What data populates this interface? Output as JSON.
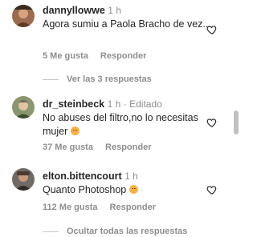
{
  "comments": [
    {
      "username": "dannyllowwe",
      "time": "1 h",
      "edited": "",
      "text": "Agora sumiu a Paola Bracho de vez...",
      "likes": "5 Me gusta",
      "reply": "Responder",
      "view_replies": "Ver las 3 respuestas"
    },
    {
      "username": "dr_steinbeck",
      "time": "1 h",
      "edited": "· Editado",
      "text": "No abuses del filtro,no lo necesitas mujer",
      "likes": "37 Me gusta",
      "reply": "Responder"
    },
    {
      "username": "elton.bittencourt",
      "time": "1 h",
      "edited": "",
      "text": "Quanto Photoshop",
      "likes": "112 Me gusta",
      "reply": "Responder",
      "hide_replies": "Ocultar todas las respuestas"
    }
  ],
  "icons": {
    "like": "heart-outline-icon",
    "emoji": "neutral-face-emoji"
  },
  "colors": {
    "text": "#262626",
    "muted": "#8e8e8e",
    "scroll_thumb": "#c1c1c1"
  }
}
